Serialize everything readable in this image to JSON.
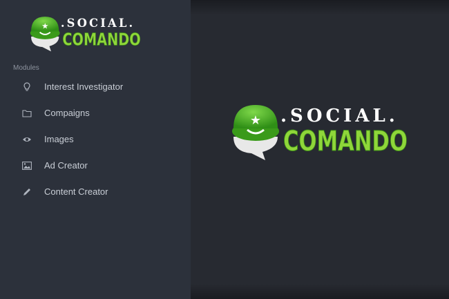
{
  "brand": {
    "word_top": ".SOCIAL.",
    "word_bottom": "COMANDO",
    "colors": {
      "green": "#4caf1f",
      "green_light": "#8fd63a",
      "white": "#ffffff"
    }
  },
  "sidebar": {
    "section_label": "Modules",
    "items": [
      {
        "label": "Interest Investigator",
        "icon": "lightbulb-icon"
      },
      {
        "label": "Compaigns",
        "icon": "folder-icon"
      },
      {
        "label": "Images",
        "icon": "eye-icon"
      },
      {
        "label": "Ad Creator",
        "icon": "image-icon"
      },
      {
        "label": "Content Creator",
        "icon": "pencil-icon"
      }
    ]
  },
  "colors": {
    "sidebar_bg": "#2c313b",
    "main_bg": "#272a31",
    "text": "#c9ced6"
  }
}
